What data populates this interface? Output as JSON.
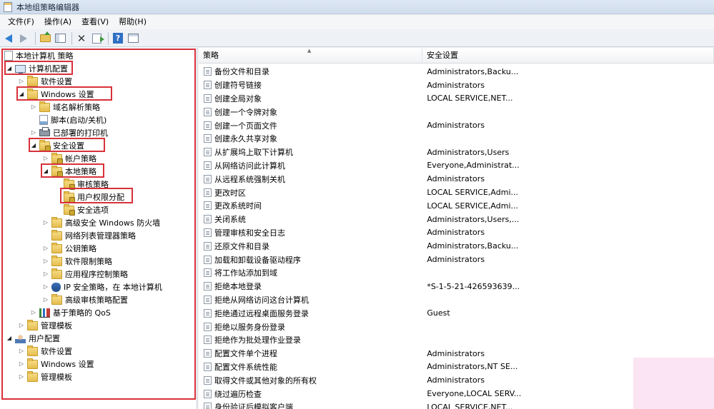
{
  "window": {
    "title": "本地组策略编辑器"
  },
  "menu": [
    "文件(F)",
    "操作(A)",
    "查看(V)",
    "帮助(H)"
  ],
  "toolbar": {
    "icons": [
      "back-arrow-icon",
      "forward-arrow-icon",
      "folder-up-icon",
      "show-tree-icon",
      "delete-icon",
      "export-list-icon",
      "help-icon",
      "properties-icon"
    ],
    "help_glyph": "?"
  },
  "tree": {
    "root": "本地计算机 策略",
    "computer_config": "计算机配置",
    "software_settings": "软件设置",
    "windows_settings": "Windows 设置",
    "dns_policy": "域名解析策略",
    "scripts": "脚本(启动/关机)",
    "printers": "已部署的打印机",
    "security_settings": "安全设置",
    "account_policies": "帐户策略",
    "local_policies": "本地策略",
    "audit_policy": "审核策略",
    "user_rights": "用户权限分配",
    "security_options": "安全选项",
    "firewall": "高级安全 Windows 防火墙",
    "network_list": "网络列表管理器策略",
    "public_key": "公钥策略",
    "software_restriction": "软件限制策略",
    "app_control": "应用程序控制策略",
    "ipsec": "IP 安全策略，在 本地计算机",
    "advanced_audit": "高级审核策略配置",
    "qos": "基于策略的 QoS",
    "admin_templates": "管理模板",
    "user_config": "用户配置",
    "user_software_settings": "软件设置",
    "user_windows_settings": "Windows 设置",
    "user_admin_templates": "管理模板"
  },
  "list": {
    "col_policy": "策略",
    "col_setting": "安全设置",
    "rows": [
      {
        "policy": "备份文件和目录",
        "setting": "Administrators,Backu..."
      },
      {
        "policy": "创建符号链接",
        "setting": "Administrators"
      },
      {
        "policy": "创建全局对象",
        "setting": "LOCAL SERVICE,NET..."
      },
      {
        "policy": "创建一个令牌对象",
        "setting": ""
      },
      {
        "policy": "创建一个页面文件",
        "setting": "Administrators"
      },
      {
        "policy": "创建永久共享对象",
        "setting": ""
      },
      {
        "policy": "从扩展坞上取下计算机",
        "setting": "Administrators,Users"
      },
      {
        "policy": "从网络访问此计算机",
        "setting": "Everyone,Administrat..."
      },
      {
        "policy": "从远程系统强制关机",
        "setting": "Administrators"
      },
      {
        "policy": "更改时区",
        "setting": "LOCAL SERVICE,Admi..."
      },
      {
        "policy": "更改系统时间",
        "setting": "LOCAL SERVICE,Admi..."
      },
      {
        "policy": "关闭系统",
        "setting": "Administrators,Users,..."
      },
      {
        "policy": "管理审核和安全日志",
        "setting": "Administrators"
      },
      {
        "policy": "还原文件和目录",
        "setting": "Administrators,Backu..."
      },
      {
        "policy": "加载和卸载设备驱动程序",
        "setting": "Administrators"
      },
      {
        "policy": "将工作站添加到域",
        "setting": ""
      },
      {
        "policy": "拒绝本地登录",
        "setting": "*S-1-5-21-426593639..."
      },
      {
        "policy": "拒绝从网络访问这台计算机",
        "setting": ""
      },
      {
        "policy": "拒绝通过远程桌面服务登录",
        "setting": "Guest"
      },
      {
        "policy": "拒绝以服务身份登录",
        "setting": ""
      },
      {
        "policy": "拒绝作为批处理作业登录",
        "setting": ""
      },
      {
        "policy": "配置文件单个进程",
        "setting": "Administrators"
      },
      {
        "policy": "配置文件系统性能",
        "setting": "Administrators,NT SE..."
      },
      {
        "policy": "取得文件或其他对象的所有权",
        "setting": "Administrators"
      },
      {
        "policy": "绕过遍历检查",
        "setting": "Everyone,LOCAL SERV..."
      },
      {
        "policy": "身份验证后模拟客户端",
        "setting": "LOCAL SERVICE,NET..."
      }
    ]
  },
  "colors": {
    "highlight": "#d8313a",
    "folder": "#e5bd4f",
    "watermark": "#fbe3f2"
  }
}
